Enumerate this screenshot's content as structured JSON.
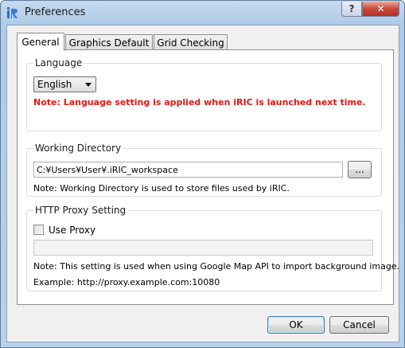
{
  "window": {
    "title": "Preferences",
    "help_label": "?",
    "close_label": "✕",
    "icon": "iric-app-icon"
  },
  "tabs": [
    {
      "label": "General",
      "active": true
    },
    {
      "label": "Graphics Default",
      "active": false
    },
    {
      "label": "Grid Checking",
      "active": false
    }
  ],
  "language": {
    "group_title": "Language",
    "selected": "English",
    "note": "Note: Language setting is applied when iRIC is launched next time.",
    "note_color": "#e8140f"
  },
  "working_directory": {
    "group_title": "Working Directory",
    "value": "C:¥Users¥User¥.iRIC_workspace",
    "browse_label": "...",
    "note": "Note: Working Directory is used to store files used by iRIC."
  },
  "proxy": {
    "group_title": "HTTP Proxy Setting",
    "use_proxy_label": "Use Proxy",
    "use_proxy_checked": false,
    "value": "",
    "note": "Note: This setting is used when using Google Map API to import background image.",
    "example": "Example: http://proxy.example.com:10080"
  },
  "buttons": {
    "ok": "OK",
    "cancel": "Cancel"
  }
}
